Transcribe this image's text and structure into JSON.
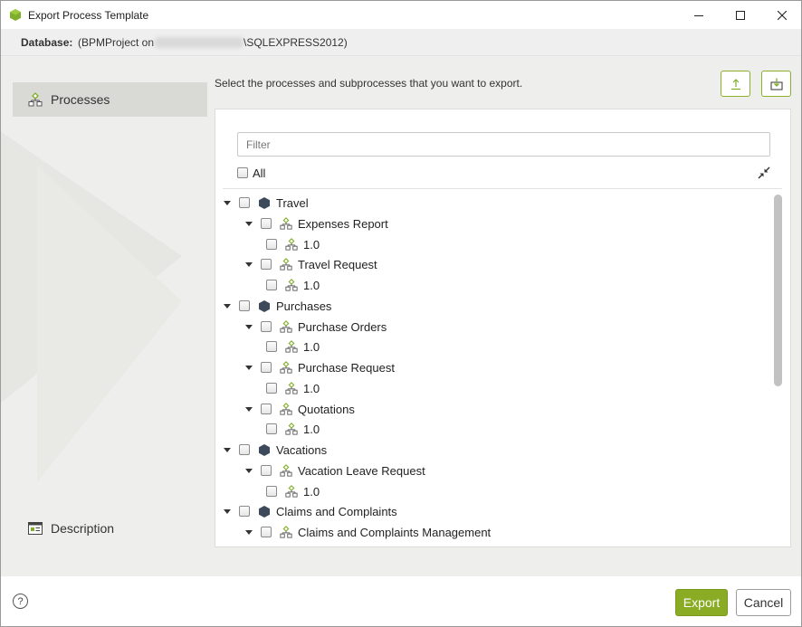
{
  "window": {
    "title": "Export Process Template"
  },
  "database": {
    "label": "Database:",
    "value_prefix": "(BPMProject on",
    "value_suffix": "\\SQLEXPRESS2012)"
  },
  "nav": {
    "processes_label": "Processes",
    "description_label": "Description"
  },
  "main": {
    "instructions": "Select the processes and subprocesses that you want to export.",
    "filter_placeholder": "Filter",
    "all_label": "All"
  },
  "tree": [
    {
      "label": "Travel",
      "icon": "category-icon"
    },
    {
      "label": "Expenses Report",
      "icon": "process-icon"
    },
    {
      "label": "1.0",
      "icon": "version-icon"
    },
    {
      "label": "Travel Request",
      "icon": "process-icon"
    },
    {
      "label": "1.0",
      "icon": "version-icon"
    },
    {
      "label": "Purchases",
      "icon": "category-icon"
    },
    {
      "label": "Purchase Orders",
      "icon": "process-icon"
    },
    {
      "label": "1.0",
      "icon": "version-icon"
    },
    {
      "label": "Purchase Request",
      "icon": "process-icon"
    },
    {
      "label": "1.0",
      "icon": "version-icon"
    },
    {
      "label": "Quotations",
      "icon": "process-icon"
    },
    {
      "label": "1.0",
      "icon": "version-icon"
    },
    {
      "label": "Vacations",
      "icon": "category-icon"
    },
    {
      "label": "Vacation Leave Request",
      "icon": "process-icon"
    },
    {
      "label": "1.0",
      "icon": "version-icon"
    },
    {
      "label": "Claims and Complaints",
      "icon": "category-icon"
    },
    {
      "label": "Claims and Complaints Management",
      "icon": "process-icon"
    }
  ],
  "footer": {
    "help": "?",
    "export_label": "Export",
    "cancel_label": "Cancel"
  },
  "colors": {
    "accent": "#8aab24",
    "category": "#3d4a5c"
  }
}
